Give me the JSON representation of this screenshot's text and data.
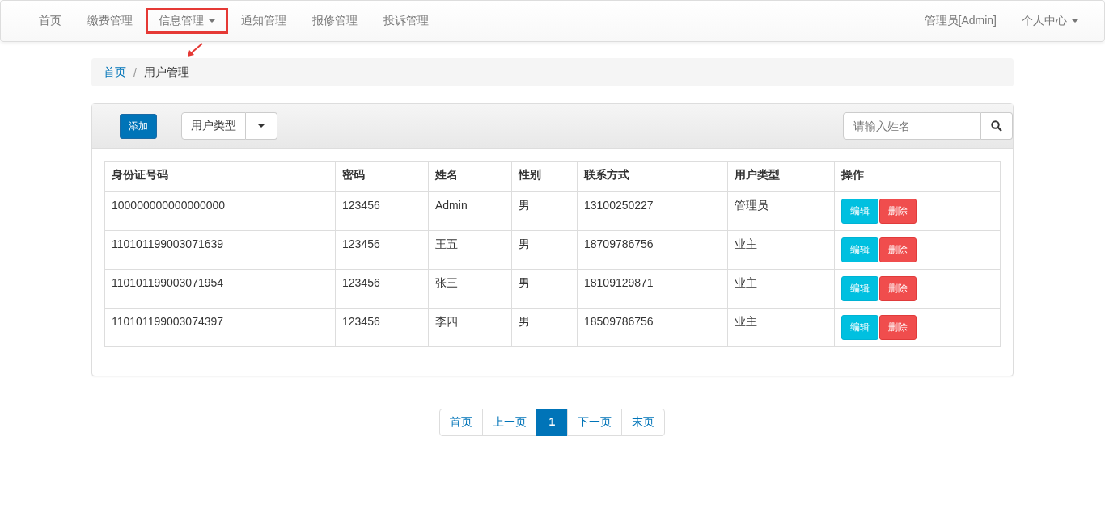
{
  "navbar": {
    "items": [
      {
        "label": "首页",
        "dropdown": false,
        "highlighted": false
      },
      {
        "label": "缴费管理",
        "dropdown": false,
        "highlighted": false
      },
      {
        "label": "信息管理",
        "dropdown": true,
        "highlighted": true
      },
      {
        "label": "通知管理",
        "dropdown": false,
        "highlighted": false
      },
      {
        "label": "报修管理",
        "dropdown": false,
        "highlighted": false
      },
      {
        "label": "投诉管理",
        "dropdown": false,
        "highlighted": false
      }
    ],
    "user": "管理员[Admin]",
    "user_menu": "个人中心"
  },
  "breadcrumb_separator": "/",
  "breadcrumb": [
    {
      "label": "首页",
      "kind": "link"
    },
    {
      "label": "用户管理",
      "kind": "current"
    }
  ],
  "toolbar": {
    "add_button": "添加",
    "filter_dropdown": "用户类型",
    "search": {
      "placeholder": "请输入姓名"
    }
  },
  "table": {
    "columns": [
      "身份证号码",
      "密码",
      "姓名",
      "性别",
      "联系方式",
      "用户类型",
      "操作"
    ],
    "rows": [
      {
        "cells": [
          "100000000000000000",
          "123456",
          "Admin",
          "男",
          "13100250227",
          "管理员"
        ],
        "actions": [
          "编辑",
          "删除"
        ]
      },
      {
        "cells": [
          "110101199003071639",
          "123456",
          "王五",
          "男",
          "18709786756",
          "业主"
        ],
        "actions": [
          "编辑",
          "删除"
        ]
      },
      {
        "cells": [
          "110101199003071954",
          "123456",
          "张三",
          "男",
          "18109129871",
          "业主"
        ],
        "actions": [
          "编辑",
          "删除"
        ]
      },
      {
        "cells": [
          "110101199003074397",
          "123456",
          "李四",
          "男",
          "18509786756",
          "业主"
        ],
        "actions": [
          "编辑",
          "删除"
        ]
      }
    ]
  },
  "pagination": [
    {
      "label": "首页",
      "selected": false
    },
    {
      "label": "上一页",
      "selected": false
    },
    {
      "label": "1",
      "selected": true
    },
    {
      "label": "下一页",
      "selected": false
    },
    {
      "label": "末页",
      "selected": false
    }
  ]
}
